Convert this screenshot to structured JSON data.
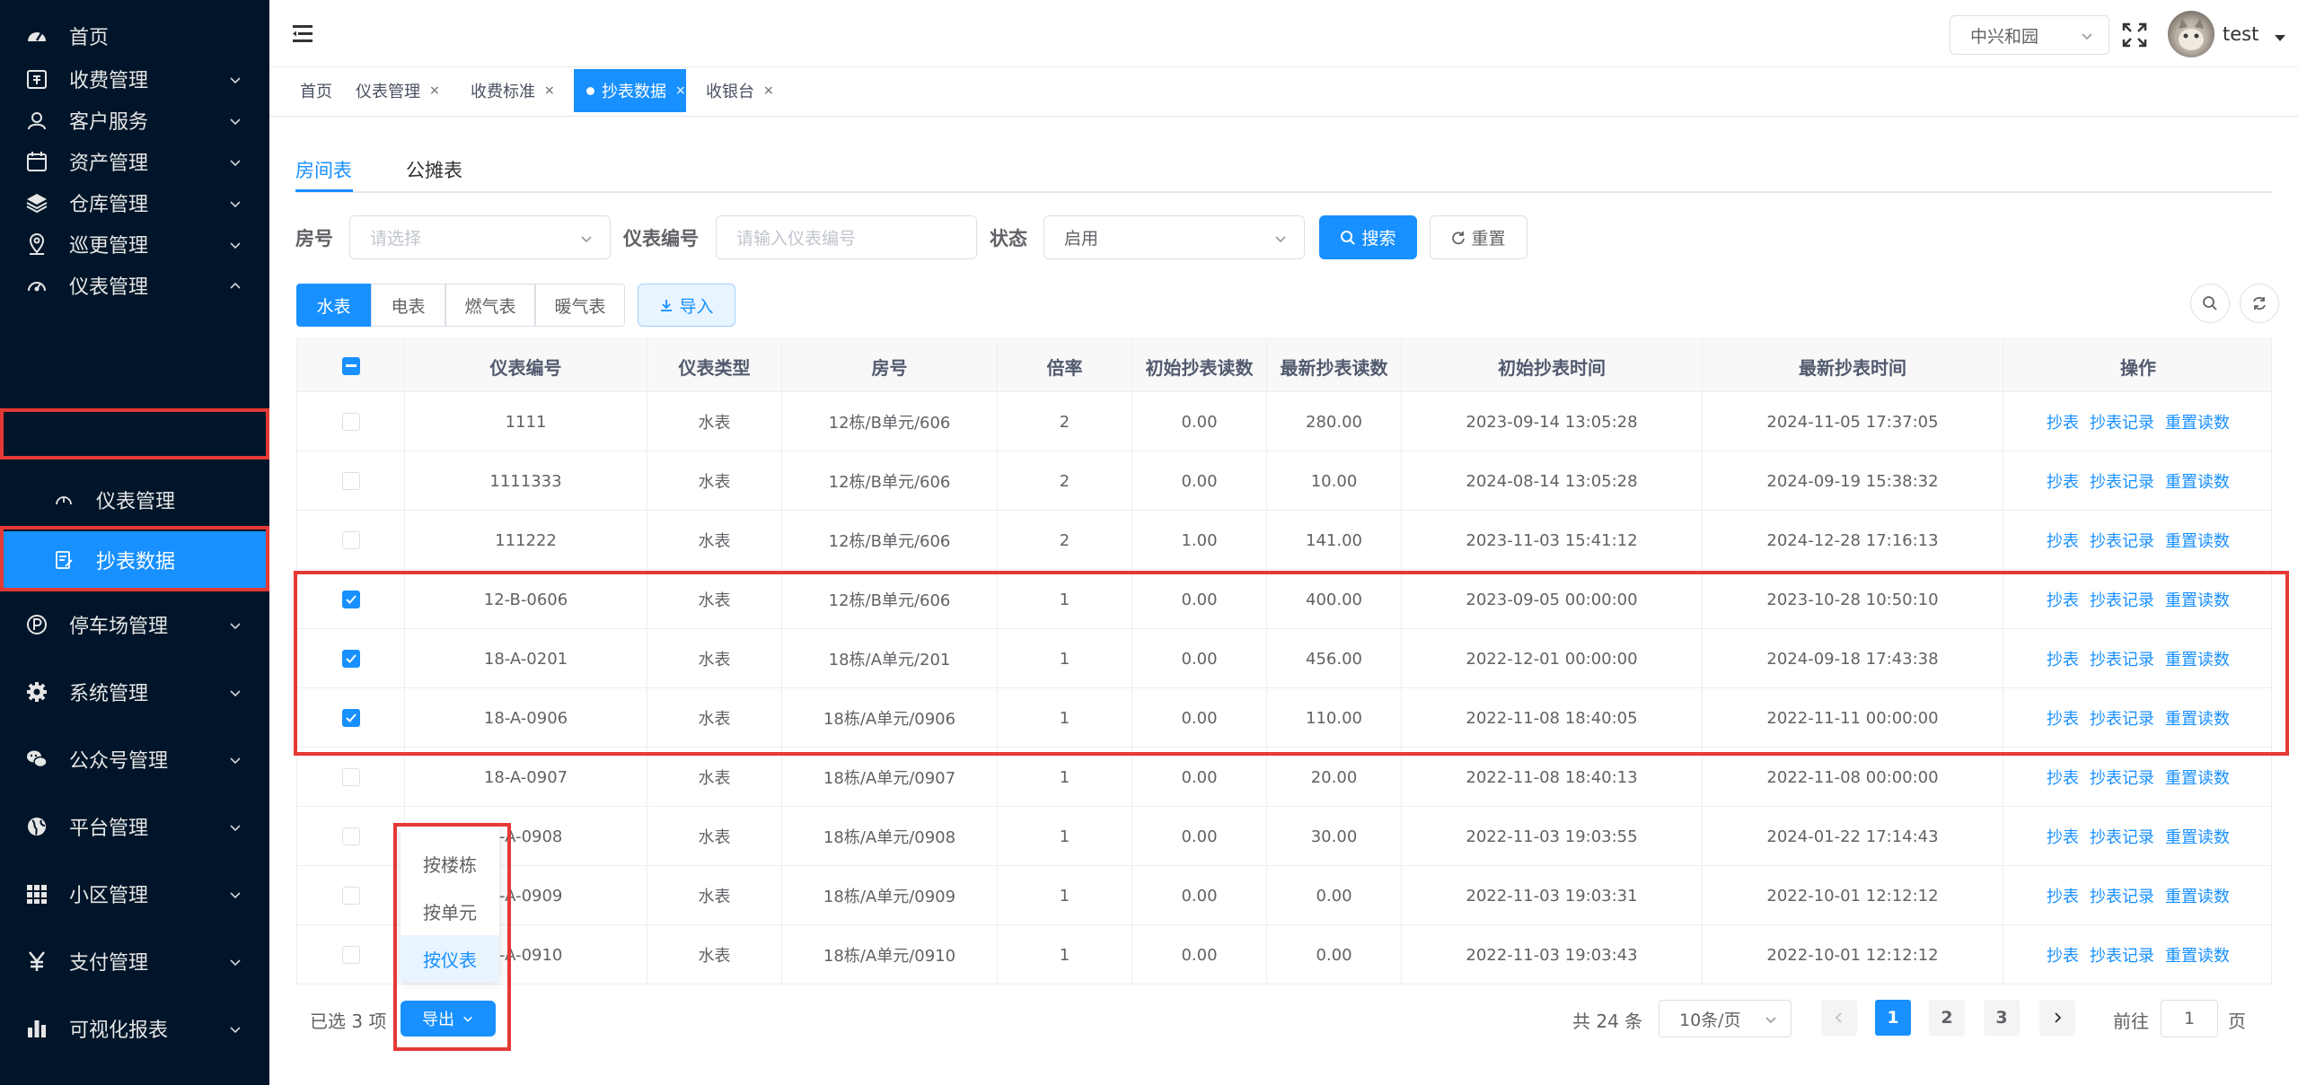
{
  "sidebar": {
    "items": [
      {
        "label": "首页",
        "icon": "dashboard-icon",
        "arrow": false
      },
      {
        "label": "收费管理",
        "icon": "wallet-icon",
        "arrow": true
      },
      {
        "label": "客户服务",
        "icon": "customer-service-icon",
        "arrow": true
      },
      {
        "label": "资产管理",
        "icon": "calendar-icon",
        "arrow": true
      },
      {
        "label": "仓库管理",
        "icon": "layers-icon",
        "arrow": true
      },
      {
        "label": "巡更管理",
        "icon": "location-pin-icon",
        "arrow": true
      },
      {
        "label": "仪表管理",
        "icon": "gauge-icon",
        "arrow": true
      }
    ],
    "sub_items": [
      {
        "label": "仪表管理",
        "icon": "meter-icon"
      },
      {
        "label": "抄表数据",
        "icon": "document-edit-icon"
      }
    ],
    "items_after": [
      {
        "label": "停车场管理",
        "icon": "parking-icon",
        "arrow": true
      },
      {
        "label": "系统管理",
        "icon": "gear-icon",
        "arrow": true
      },
      {
        "label": "公众号管理",
        "icon": "wechat-icon",
        "arrow": true
      },
      {
        "label": "平台管理",
        "icon": "globe-icon",
        "arrow": true
      },
      {
        "label": "小区管理",
        "icon": "grid-icon",
        "arrow": true
      },
      {
        "label": "支付管理",
        "icon": "yen-icon",
        "arrow": true
      },
      {
        "label": "可视化报表",
        "icon": "bar-chart-icon",
        "arrow": true
      }
    ]
  },
  "header": {
    "community_select": "中兴和园",
    "username": "test"
  },
  "tags": [
    {
      "label": "首页",
      "closable": false,
      "active": false
    },
    {
      "label": "仪表管理",
      "closable": true,
      "active": false
    },
    {
      "label": "收费标准",
      "closable": true,
      "active": false
    },
    {
      "label": "抄表数据",
      "closable": true,
      "active": true
    },
    {
      "label": "收银台",
      "closable": true,
      "active": false
    }
  ],
  "tag_close_glyph": "×",
  "subtabs": {
    "room": "房间表",
    "shared": "公摊表"
  },
  "filters": {
    "room_label": "房号",
    "room_placeholder": "请选择",
    "meter_label": "仪表编号",
    "meter_placeholder": "请输入仪表编号",
    "status_label": "状态",
    "status_value": "启用",
    "search_btn": "搜索",
    "reset_btn": "重置"
  },
  "meter_types": [
    "水表",
    "电表",
    "燃气表",
    "暖气表"
  ],
  "import_btn": "导入",
  "table": {
    "headers": [
      "仪表编号",
      "仪表类型",
      "房号",
      "倍率",
      "初始抄表读数",
      "最新抄表读数",
      "初始抄表时间",
      "最新抄表时间",
      "操作"
    ],
    "actions": [
      "抄表",
      "抄表记录",
      "重置读数"
    ],
    "rows": [
      {
        "checked": false,
        "cells": [
          "1111",
          "水表",
          "12栋/B单元/606",
          "2",
          "0.00",
          "280.00",
          "2023-09-14 13:05:28",
          "2024-11-05 17:37:05"
        ]
      },
      {
        "checked": false,
        "cells": [
          "1111333",
          "水表",
          "12栋/B单元/606",
          "2",
          "0.00",
          "10.00",
          "2024-08-14 13:05:28",
          "2024-09-19 15:38:32"
        ]
      },
      {
        "checked": false,
        "cells": [
          "111222",
          "水表",
          "12栋/B单元/606",
          "2",
          "1.00",
          "141.00",
          "2023-11-03 15:41:12",
          "2024-12-28 17:16:13"
        ]
      },
      {
        "checked": true,
        "cells": [
          "12-B-0606",
          "水表",
          "12栋/B单元/606",
          "1",
          "0.00",
          "400.00",
          "2023-09-05 00:00:00",
          "2023-10-28 10:50:10"
        ]
      },
      {
        "checked": true,
        "cells": [
          "18-A-0201",
          "水表",
          "18栋/A单元/201",
          "1",
          "0.00",
          "456.00",
          "2022-12-01 00:00:00",
          "2024-09-18 17:43:38"
        ]
      },
      {
        "checked": true,
        "cells": [
          "18-A-0906",
          "水表",
          "18栋/A单元/0906",
          "1",
          "0.00",
          "110.00",
          "2022-11-08 18:40:05",
          "2022-11-11 00:00:00"
        ]
      },
      {
        "checked": false,
        "cells": [
          "18-A-0907",
          "水表",
          "18栋/A单元/0907",
          "1",
          "0.00",
          "20.00",
          "2022-11-08 18:40:13",
          "2022-11-08 00:00:00"
        ]
      },
      {
        "checked": false,
        "cells": [
          "3-A-0908",
          "水表",
          "18栋/A单元/0908",
          "1",
          "0.00",
          "30.00",
          "2022-11-03 19:03:55",
          "2024-01-22 17:14:43"
        ]
      },
      {
        "checked": false,
        "cells": [
          "3-A-0909",
          "水表",
          "18栋/A单元/0909",
          "1",
          "0.00",
          "0.00",
          "2022-11-03 19:03:31",
          "2022-10-01 12:12:12"
        ]
      },
      {
        "checked": false,
        "cells": [
          "3-A-0910",
          "水表",
          "18栋/A单元/0910",
          "1",
          "0.00",
          "0.00",
          "2022-11-03 19:03:43",
          "2022-10-01 12:12:12"
        ]
      }
    ]
  },
  "footer": {
    "selected": "已选 3 项",
    "export_btn": "导出",
    "export_menu": [
      "按楼栋",
      "按单元",
      "按仪表"
    ],
    "total": "共 24 条",
    "page_size": "10条/页",
    "pages": [
      "1",
      "2",
      "3"
    ],
    "goto_prefix": "前往",
    "goto_value": "1",
    "goto_suffix": "页"
  }
}
